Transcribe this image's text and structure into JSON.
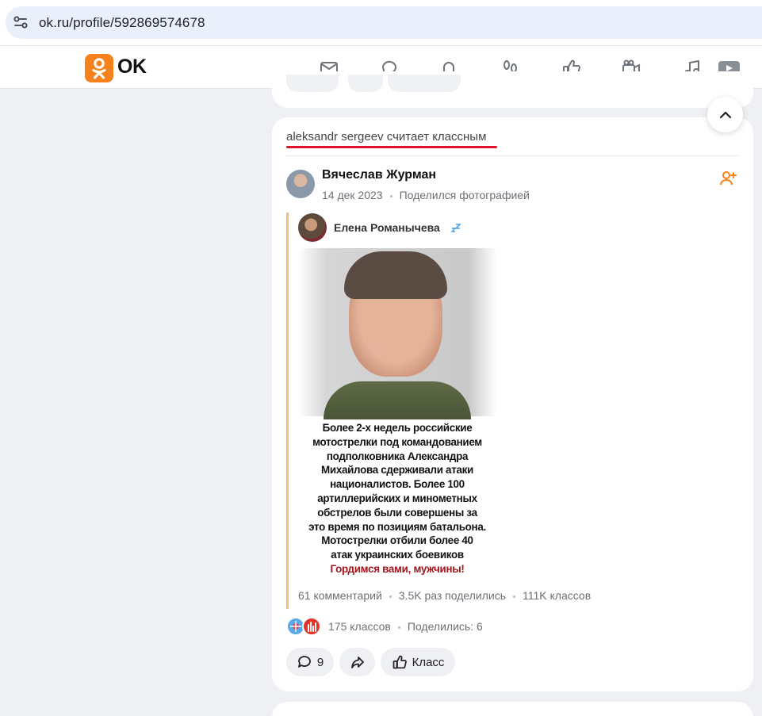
{
  "browser": {
    "url": "ok.ru/profile/592869574678"
  },
  "header": {
    "logo_text": "OK",
    "nav_icons": [
      "mail-icon",
      "chat-icon",
      "bell-icon",
      "footprints-icon",
      "thumb-up-icon",
      "camera-icon",
      "music-note-icon",
      "video-play-icon"
    ]
  },
  "post": {
    "liked_by_text": "aleksandr sergeev считает классным",
    "author": "Вячеслав Журман",
    "date": "14 дек 2023",
    "action": "Поделился фотографией",
    "repost": {
      "author": "Елена Романычева",
      "caption_lines": [
        "Более 2-х недель российские",
        "мотострелки под командованием",
        "подполковника Александра",
        "Михайлова сдерживали атаки",
        "националистов. Более 100",
        "артиллерийских и минометных",
        "обстрелов были совершены за",
        "это время по позициям батальона.",
        "Мотострелки отбили более 40",
        "атак украинских боевиков"
      ],
      "caption_highlight": "Гордимся вами, мужчины!",
      "stats": {
        "comments": "61 комментарий",
        "shares": "3.5K раз поделились",
        "likes": "111K классов"
      }
    },
    "reactions": {
      "likes": "175 классов",
      "shares": "Поделились: 6"
    },
    "actions": {
      "comments_count": "9",
      "like_label": "Класс"
    }
  },
  "colors": {
    "brand": "#f7811b",
    "highlight_red": "#e0102a",
    "caption_red": "#a3151d"
  }
}
